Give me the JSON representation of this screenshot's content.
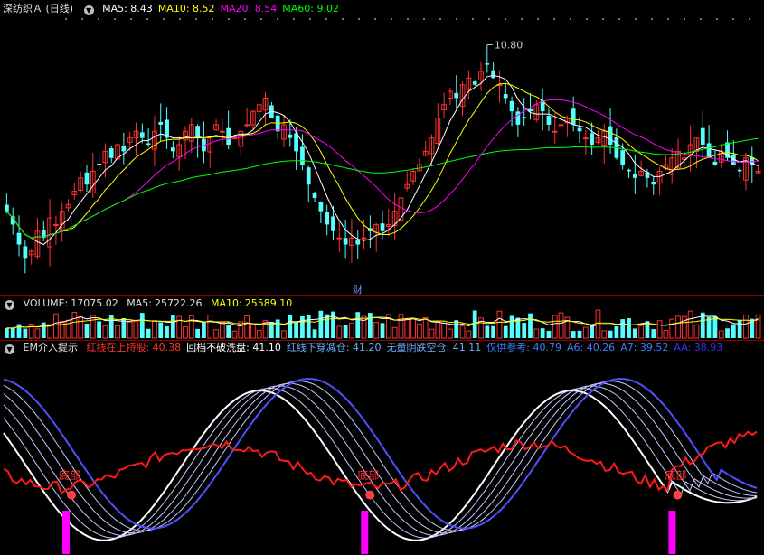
{
  "main_panel": {
    "title": "深纺织Ａ (日线)",
    "ma_labels": [
      {
        "text": "MA5: 8.43",
        "color": "#ffffff"
      },
      {
        "text": "MA10: 8.52",
        "color": "#ffff00"
      },
      {
        "text": "MA20: 8.54",
        "color": "#ff00ff"
      },
      {
        "text": "MA60: 9.02",
        "color": "#00ff00"
      }
    ],
    "high_label": "10.80",
    "finance_marker": "财"
  },
  "volume_panel": {
    "name": "VOLUME:",
    "value": "17075.02",
    "ma5_label": "MA5:",
    "ma5_value": "25722.26",
    "ma10_label": "MA10:",
    "ma10_value": "25589.10"
  },
  "em_panel": {
    "title": "EM介入提示",
    "legend": [
      {
        "text": "红线在上持股: 40.38",
        "color": "#ff3030"
      },
      {
        "text": "回档不破洗盘: 41.10",
        "color": "#ffffff"
      },
      {
        "text": "红线下穿减仓: 41.20",
        "color": "#6ab0ff"
      },
      {
        "text": "无量阴跌空仓: 41.11",
        "color": "#6ab0ff"
      },
      {
        "text": "仅供参考: 40.79",
        "color": "#3a7fff"
      },
      {
        "text": "A6: 40.26",
        "color": "#3a7fff"
      },
      {
        "text": "A7: 39.52",
        "color": "#3a7fff"
      },
      {
        "text": "AA: 38.93",
        "color": "#3030ff"
      }
    ],
    "markers": {
      "bottom": "底部",
      "sell": "卖出"
    }
  },
  "chart_data": [
    {
      "type": "candlestick",
      "title": "深纺织Ａ (日线)",
      "price_labels": {
        "high": 10.8
      },
      "ma_last": {
        "MA5": 8.43,
        "MA10": 8.52,
        "MA20": 8.54,
        "MA60": 9.02
      },
      "ylim": [
        7.4,
        11.2
      ],
      "close": [
        8.3,
        8.1,
        7.8,
        7.6,
        7.7,
        8.0,
        7.9,
        8.2,
        8.1,
        8.3,
        8.4,
        8.6,
        8.8,
        8.7,
        8.9,
        9.0,
        9.2,
        9.1,
        9.3,
        9.2,
        9.4,
        9.5,
        9.4,
        9.3,
        9.5,
        9.6,
        9.4,
        9.2,
        9.3,
        9.5,
        9.6,
        9.4,
        9.2,
        9.4,
        9.6,
        9.5,
        9.3,
        9.4,
        9.5,
        9.6,
        9.8,
        9.9,
        10.0,
        9.7,
        9.5,
        9.6,
        9.4,
        9.2,
        9.0,
        8.7,
        8.5,
        8.3,
        8.1,
        8.0,
        7.9,
        7.8,
        7.9,
        7.8,
        7.9,
        8.0,
        8.1,
        8.0,
        8.1,
        8.3,
        8.5,
        8.7,
        8.9,
        9.0,
        9.2,
        9.4,
        9.7,
        9.9,
        10.1,
        10.0,
        10.2,
        10.3,
        10.2,
        10.4,
        10.5,
        10.3,
        10.2,
        10.0,
        9.8,
        9.6,
        9.7,
        9.8,
        9.9,
        9.8,
        9.6,
        9.5,
        9.6,
        9.7,
        9.6,
        9.5,
        9.4,
        9.3,
        9.4,
        9.5,
        9.3,
        9.1,
        9.0,
        8.9,
        8.8,
        8.9,
        8.8,
        8.7,
        8.9,
        9.0,
        9.1,
        9.2,
        9.1,
        9.3,
        9.4,
        9.3,
        9.1,
        9.0,
        9.2,
        9.1,
        9.0,
        8.9,
        9.1,
        9.0,
        8.9
      ]
    },
    {
      "type": "bar",
      "title": "VOLUME",
      "series": [
        {
          "name": "VOLUME",
          "last": 17075.02
        },
        {
          "name": "MA5",
          "last": 25722.26
        },
        {
          "name": "MA10",
          "last": 25589.1
        }
      ]
    },
    {
      "type": "line",
      "title": "EM介入提示",
      "ylim": [
        0,
        100
      ],
      "series": [
        {
          "name": "红线在上持股",
          "last": 40.38,
          "color": "#ff2020"
        },
        {
          "name": "回档不破洗盘",
          "last": 41.1,
          "color": "#ffffff"
        },
        {
          "name": "红线下穿减仓",
          "last": 41.2
        },
        {
          "name": "无量阴跌空仓",
          "last": 41.11
        },
        {
          "name": "仅供参考",
          "last": 40.79
        },
        {
          "name": "A6",
          "last": 40.26
        },
        {
          "name": "A7",
          "last": 39.52
        },
        {
          "name": "AA",
          "last": 38.93,
          "color": "#4040ff"
        }
      ],
      "signals": [
        {
          "label": "底部",
          "index": 14
        },
        {
          "label": "底部",
          "index": 81
        },
        {
          "label": "底部",
          "index": 150
        }
      ]
    }
  ]
}
